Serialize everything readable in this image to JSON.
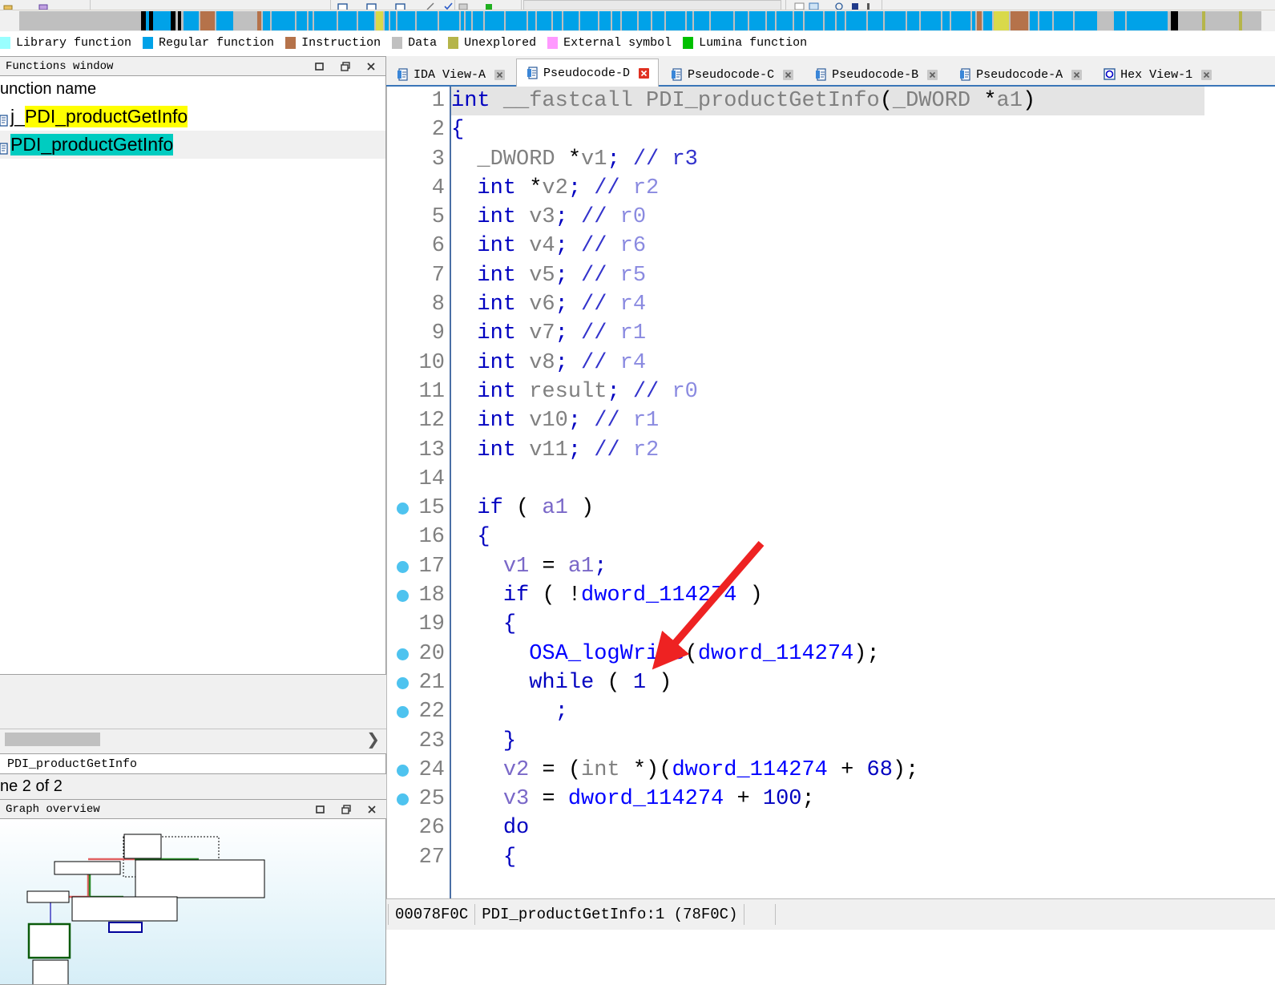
{
  "legend": {
    "items": [
      {
        "label": "Library function",
        "color": "#99ffff"
      },
      {
        "label": "Regular function",
        "color": "#00a2e8"
      },
      {
        "label": "Instruction",
        "color": "#b5724a"
      },
      {
        "label": "Data",
        "color": "#c0c0c0"
      },
      {
        "label": "Unexplored",
        "color": "#b5b54a"
      },
      {
        "label": "External symbol",
        "color": "#ff99ff"
      },
      {
        "label": "Lumina function",
        "color": "#00c000"
      }
    ]
  },
  "functions_panel": {
    "title": "Functions window",
    "column_header": "unction name",
    "rows": [
      {
        "prefix": "j_",
        "name": "PDI_productGetInfo",
        "highlight": "yellow"
      },
      {
        "prefix": "",
        "name": "PDI_productGetInfo",
        "highlight": "teal"
      }
    ],
    "status": "PDI_productGetInfo",
    "count": "ne 2 of 2",
    "window_buttons": [
      "restore-button",
      "dock-button",
      "close-button"
    ]
  },
  "graph_overview": {
    "title": "Graph overview",
    "window_buttons": [
      "restore-button",
      "dock-button",
      "close-button"
    ]
  },
  "tabs": [
    {
      "label": "IDA View-A",
      "icon": "document-icon",
      "active": false,
      "close": "close-icon"
    },
    {
      "label": "Pseudocode-D",
      "icon": "document-icon",
      "active": true,
      "close": "close-icon-active"
    },
    {
      "label": "Pseudocode-C",
      "icon": "document-icon",
      "active": false,
      "close": "close-icon"
    },
    {
      "label": "Pseudocode-B",
      "icon": "document-icon",
      "active": false,
      "close": "close-icon"
    },
    {
      "label": "Pseudocode-A",
      "icon": "document-icon",
      "active": false,
      "close": "close-icon"
    },
    {
      "label": "Hex View-1",
      "icon": "hex-icon",
      "active": false,
      "close": "close-icon"
    }
  ],
  "code": {
    "lines": [
      {
        "n": "1",
        "dot": false,
        "current": true,
        "tokens": [
          [
            "kw",
            "int"
          ],
          [
            "pl",
            " "
          ],
          [
            "ty",
            "__fastcall"
          ],
          [
            "pl",
            " "
          ],
          [
            "ty",
            "PDI_productGetInfo"
          ],
          [
            "pl",
            "("
          ],
          [
            "ty",
            "_DWORD"
          ],
          [
            "pl",
            " *"
          ],
          [
            "ty",
            "a1"
          ],
          [
            "pl",
            ")"
          ]
        ]
      },
      {
        "n": "2",
        "dot": false,
        "current": false,
        "tokens": [
          [
            "kw",
            "{"
          ]
        ]
      },
      {
        "n": "3",
        "dot": false,
        "current": false,
        "tokens": [
          [
            "pl",
            "  "
          ],
          [
            "ty",
            "_DWORD"
          ],
          [
            "pl",
            " *"
          ],
          [
            "ty",
            "v1"
          ],
          [
            "kw",
            ";"
          ],
          [
            "pl",
            " "
          ],
          [
            "cm",
            "// r3"
          ]
        ]
      },
      {
        "n": "4",
        "dot": false,
        "current": false,
        "tokens": [
          [
            "pl",
            "  "
          ],
          [
            "kw",
            "int"
          ],
          [
            "pl",
            " *"
          ],
          [
            "ty",
            "v2"
          ],
          [
            "kw",
            ";"
          ],
          [
            "pl",
            " "
          ],
          [
            "cm",
            "// "
          ],
          [
            "reg",
            "r2"
          ]
        ]
      },
      {
        "n": "5",
        "dot": false,
        "current": false,
        "tokens": [
          [
            "pl",
            "  "
          ],
          [
            "kw",
            "int"
          ],
          [
            "pl",
            " "
          ],
          [
            "ty",
            "v3"
          ],
          [
            "kw",
            ";"
          ],
          [
            "pl",
            " "
          ],
          [
            "cm",
            "// "
          ],
          [
            "reg",
            "r0"
          ]
        ]
      },
      {
        "n": "6",
        "dot": false,
        "current": false,
        "tokens": [
          [
            "pl",
            "  "
          ],
          [
            "kw",
            "int"
          ],
          [
            "pl",
            " "
          ],
          [
            "ty",
            "v4"
          ],
          [
            "kw",
            ";"
          ],
          [
            "pl",
            " "
          ],
          [
            "cm",
            "// "
          ],
          [
            "reg",
            "r6"
          ]
        ]
      },
      {
        "n": "7",
        "dot": false,
        "current": false,
        "tokens": [
          [
            "pl",
            "  "
          ],
          [
            "kw",
            "int"
          ],
          [
            "pl",
            " "
          ],
          [
            "ty",
            "v5"
          ],
          [
            "kw",
            ";"
          ],
          [
            "pl",
            " "
          ],
          [
            "cm",
            "// "
          ],
          [
            "reg",
            "r5"
          ]
        ]
      },
      {
        "n": "8",
        "dot": false,
        "current": false,
        "tokens": [
          [
            "pl",
            "  "
          ],
          [
            "kw",
            "int"
          ],
          [
            "pl",
            " "
          ],
          [
            "ty",
            "v6"
          ],
          [
            "kw",
            ";"
          ],
          [
            "pl",
            " "
          ],
          [
            "cm",
            "// "
          ],
          [
            "reg",
            "r4"
          ]
        ]
      },
      {
        "n": "9",
        "dot": false,
        "current": false,
        "tokens": [
          [
            "pl",
            "  "
          ],
          [
            "kw",
            "int"
          ],
          [
            "pl",
            " "
          ],
          [
            "ty",
            "v7"
          ],
          [
            "kw",
            ";"
          ],
          [
            "pl",
            " "
          ],
          [
            "cm",
            "// "
          ],
          [
            "reg",
            "r1"
          ]
        ]
      },
      {
        "n": "10",
        "dot": false,
        "current": false,
        "tokens": [
          [
            "pl",
            "  "
          ],
          [
            "kw",
            "int"
          ],
          [
            "pl",
            " "
          ],
          [
            "ty",
            "v8"
          ],
          [
            "kw",
            ";"
          ],
          [
            "pl",
            " "
          ],
          [
            "cm",
            "// "
          ],
          [
            "reg",
            "r4"
          ]
        ]
      },
      {
        "n": "11",
        "dot": false,
        "current": false,
        "tokens": [
          [
            "pl",
            "  "
          ],
          [
            "kw",
            "int"
          ],
          [
            "pl",
            " "
          ],
          [
            "ty",
            "result"
          ],
          [
            "kw",
            ";"
          ],
          [
            "pl",
            " "
          ],
          [
            "cm",
            "// "
          ],
          [
            "reg",
            "r0"
          ]
        ]
      },
      {
        "n": "12",
        "dot": false,
        "current": false,
        "tokens": [
          [
            "pl",
            "  "
          ],
          [
            "kw",
            "int"
          ],
          [
            "pl",
            " "
          ],
          [
            "ty",
            "v10"
          ],
          [
            "kw",
            ";"
          ],
          [
            "pl",
            " "
          ],
          [
            "cm",
            "// "
          ],
          [
            "reg",
            "r1"
          ]
        ]
      },
      {
        "n": "13",
        "dot": false,
        "current": false,
        "tokens": [
          [
            "pl",
            "  "
          ],
          [
            "kw",
            "int"
          ],
          [
            "pl",
            " "
          ],
          [
            "ty",
            "v11"
          ],
          [
            "kw",
            ";"
          ],
          [
            "pl",
            " "
          ],
          [
            "cm",
            "// "
          ],
          [
            "reg",
            "r2"
          ]
        ]
      },
      {
        "n": "14",
        "dot": false,
        "current": false,
        "tokens": [
          [
            "pl",
            ""
          ]
        ]
      },
      {
        "n": "15",
        "dot": true,
        "current": false,
        "tokens": [
          [
            "pl",
            "  "
          ],
          [
            "kw",
            "if"
          ],
          [
            "pl",
            " ( "
          ],
          [
            "arg",
            "a1"
          ],
          [
            "pl",
            " )"
          ]
        ]
      },
      {
        "n": "16",
        "dot": false,
        "current": false,
        "tokens": [
          [
            "pl",
            "  "
          ],
          [
            "kw",
            "{"
          ]
        ]
      },
      {
        "n": "17",
        "dot": true,
        "current": false,
        "tokens": [
          [
            "pl",
            "    "
          ],
          [
            "var",
            "v1"
          ],
          [
            "pl",
            " = "
          ],
          [
            "arg",
            "a1"
          ],
          [
            "kw",
            ";"
          ]
        ]
      },
      {
        "n": "18",
        "dot": true,
        "current": false,
        "tokens": [
          [
            "pl",
            "    "
          ],
          [
            "kw",
            "if"
          ],
          [
            "pl",
            " ( !"
          ],
          [
            "glb",
            "dword_114274"
          ],
          [
            "pl",
            " )"
          ]
        ]
      },
      {
        "n": "19",
        "dot": false,
        "current": false,
        "tokens": [
          [
            "pl",
            "    "
          ],
          [
            "kw",
            "{"
          ]
        ]
      },
      {
        "n": "20",
        "dot": true,
        "current": false,
        "tokens": [
          [
            "pl",
            "      "
          ],
          [
            "fnc",
            "OSA_logWrite"
          ],
          [
            "pl",
            "("
          ],
          [
            "glb",
            "dword_114274"
          ],
          [
            "pl",
            ");"
          ]
        ]
      },
      {
        "n": "21",
        "dot": true,
        "current": false,
        "tokens": [
          [
            "pl",
            "      "
          ],
          [
            "kw",
            "while"
          ],
          [
            "pl",
            " ( "
          ],
          [
            "num0",
            "1"
          ],
          [
            "pl",
            " )"
          ]
        ]
      },
      {
        "n": "22",
        "dot": true,
        "current": false,
        "tokens": [
          [
            "pl",
            "        "
          ],
          [
            "kw",
            ";"
          ]
        ]
      },
      {
        "n": "23",
        "dot": false,
        "current": false,
        "tokens": [
          [
            "pl",
            "    "
          ],
          [
            "kw",
            "}"
          ]
        ]
      },
      {
        "n": "24",
        "dot": true,
        "current": false,
        "tokens": [
          [
            "pl",
            "    "
          ],
          [
            "var",
            "v2"
          ],
          [
            "pl",
            " = ("
          ],
          [
            "ty",
            "int"
          ],
          [
            "pl",
            " *)("
          ],
          [
            "glb",
            "dword_114274"
          ],
          [
            "pl",
            " + "
          ],
          [
            "num0",
            "68"
          ],
          [
            "pl",
            ");"
          ]
        ]
      },
      {
        "n": "25",
        "dot": true,
        "current": false,
        "tokens": [
          [
            "pl",
            "    "
          ],
          [
            "var",
            "v3"
          ],
          [
            "pl",
            " = "
          ],
          [
            "glb",
            "dword_114274"
          ],
          [
            "pl",
            " + "
          ],
          [
            "num0",
            "100"
          ],
          [
            "pl",
            ";"
          ]
        ]
      },
      {
        "n": "26",
        "dot": false,
        "current": false,
        "tokens": [
          [
            "pl",
            "    "
          ],
          [
            "kw",
            "do"
          ]
        ]
      },
      {
        "n": "27",
        "dot": false,
        "current": false,
        "tokens": [
          [
            "pl",
            "    "
          ],
          [
            "kw",
            "{"
          ]
        ]
      }
    ]
  },
  "status_bar": {
    "address": "00078F0C",
    "location": "PDI_productGetInfo:1  (78F0C)"
  },
  "annotation": {
    "arrow_color": "#ee2222",
    "points_at": "OSA_logWrite"
  },
  "colors": {
    "accent_blue": "#00a2e8",
    "tab_underline": "#3a76b8",
    "marker_dot": "#4ec3ef",
    "highlight_yellow": "#ffff00",
    "highlight_teal": "#00ccc0"
  }
}
